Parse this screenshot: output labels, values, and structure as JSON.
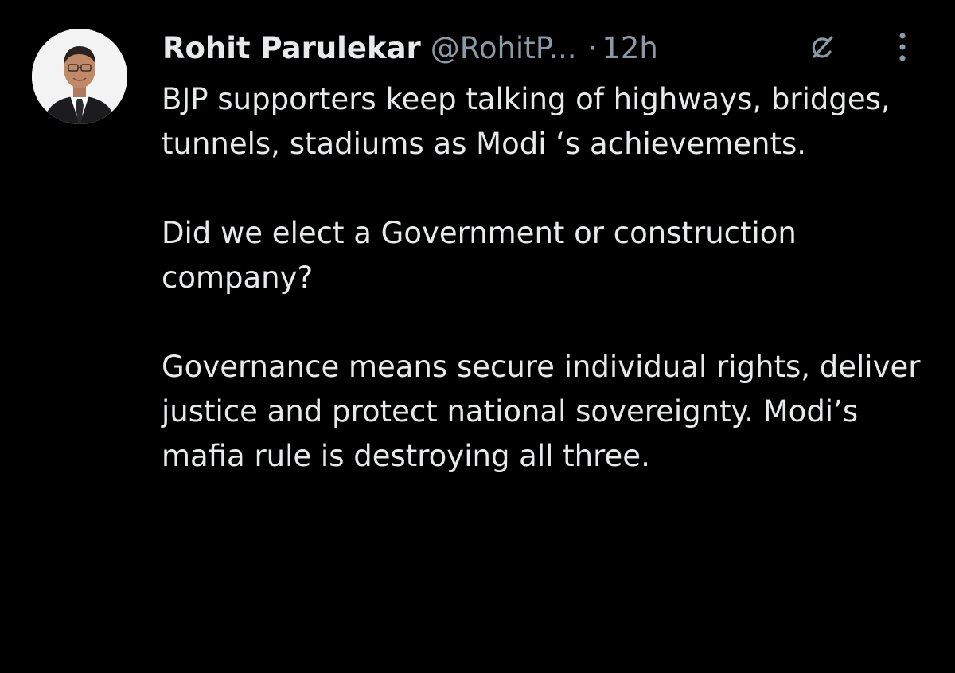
{
  "tweet": {
    "author": {
      "display_name": "Rohit Parulekar",
      "handle": "@RohitP...",
      "avatar_icon": "profile-photo"
    },
    "separator": "·",
    "timestamp": "12h",
    "header_icons": {
      "grok": "grok-icon",
      "more": "more-options-icon"
    },
    "paragraphs": [
      "BJP supporters keep talking of highways, bridges, tunnels, stadiums as Modi ‘s achievements.",
      "Did we elect a Government or construction company?",
      "Governance means secure individual rights, deliver justice and protect national sovereignty. Modi’s mafia rule is destroying all three."
    ]
  },
  "colors": {
    "background": "#000000",
    "primary_text": "#e7e9ea",
    "secondary_text": "#8b98a5"
  }
}
